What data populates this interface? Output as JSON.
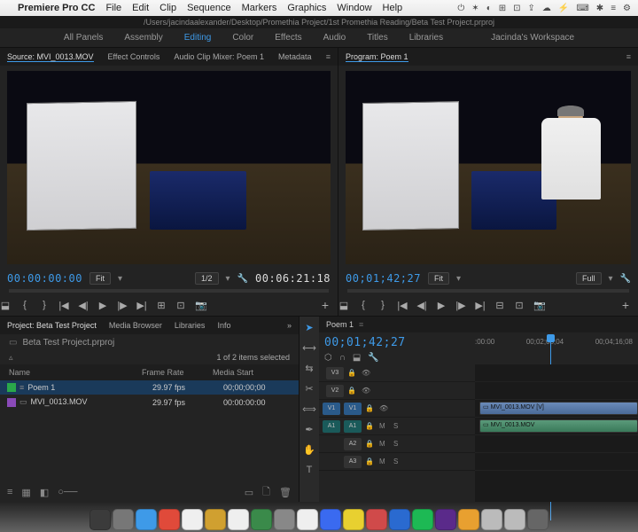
{
  "menubar": {
    "app": "Premiere Pro CC",
    "items": [
      "File",
      "Edit",
      "Clip",
      "Sequence",
      "Markers",
      "Graphics",
      "Window",
      "Help"
    ],
    "right": [
      "⏻",
      "✶",
      "◐",
      "⊞",
      "⊡",
      "⇪",
      "☁",
      "⚡",
      "⌨",
      "✱",
      "≡",
      "⚙"
    ]
  },
  "pathbar": "/Users/jacindaalexander/Desktop/Promethia Project/1st Promethia Reading/Beta Test Project.prproj",
  "workspaces": {
    "items": [
      "All Panels",
      "Assembly",
      "Editing",
      "Color",
      "Effects",
      "Audio",
      "Titles",
      "Libraries"
    ],
    "active": 2,
    "user": "Jacinda's Workspace"
  },
  "source": {
    "tabs": [
      "Source: MVI_0013.MOV",
      "Effect Controls",
      "Audio Clip Mixer: Poem 1",
      "Metadata"
    ],
    "tc_in": "00:00:00:00",
    "zoom_l": "Fit",
    "half": "1/2",
    "tc_out": "00:06:21:18"
  },
  "program": {
    "tabs": [
      "Program: Poem 1"
    ],
    "tc": "00;01;42;27",
    "zoom": "Fit",
    "quality": "Full"
  },
  "project": {
    "tabs": [
      "Project: Beta Test Project",
      "Media Browser",
      "Libraries",
      "Info"
    ],
    "filename": "Beta Test Project.prproj",
    "selection": "1 of 2 items selected",
    "cols": {
      "name": "Name",
      "rate": "Frame Rate",
      "start": "Media Start"
    },
    "rows": [
      {
        "name": "Poem 1",
        "rate": "29.97 fps",
        "start": "00;00;00;00",
        "swatch": "#2aa84a",
        "icon": "≡",
        "sel": true
      },
      {
        "name": "MVI_0013.MOV",
        "rate": "29.97 fps",
        "start": "00:00:00:00",
        "swatch": "#8a4ab8",
        "icon": "▭",
        "sel": false
      }
    ]
  },
  "timeline": {
    "seq": "Poem 1",
    "tc": "00;01;42;27",
    "ruler": [
      ":00:00",
      "00;02;08;04",
      "00;04;16;08"
    ],
    "vtracks": [
      {
        "s": "",
        "l": "V3"
      },
      {
        "s": "",
        "l": "V2"
      },
      {
        "s": "V1",
        "l": "V1"
      }
    ],
    "atracks": [
      {
        "s": "A1",
        "l": "A1"
      },
      {
        "s": "",
        "l": "A2"
      },
      {
        "s": "",
        "l": "A3"
      }
    ],
    "clip_v": "MVI_0013.MOV [V]",
    "clip_a": "MVI_0013.MOV"
  },
  "dock": [
    "#3b3b3b",
    "#777",
    "#3e9ae8",
    "#e04a3a",
    "#efefef",
    "#d0a030",
    "#efefef",
    "#3a8a4a",
    "#888",
    "#efefef",
    "#3a6af0",
    "#e8d030",
    "#d04a4a",
    "#2a6ad0",
    "#1db954",
    "#5a2a8a",
    "#e8a030",
    "#bbb",
    "#bbb",
    "#666"
  ]
}
